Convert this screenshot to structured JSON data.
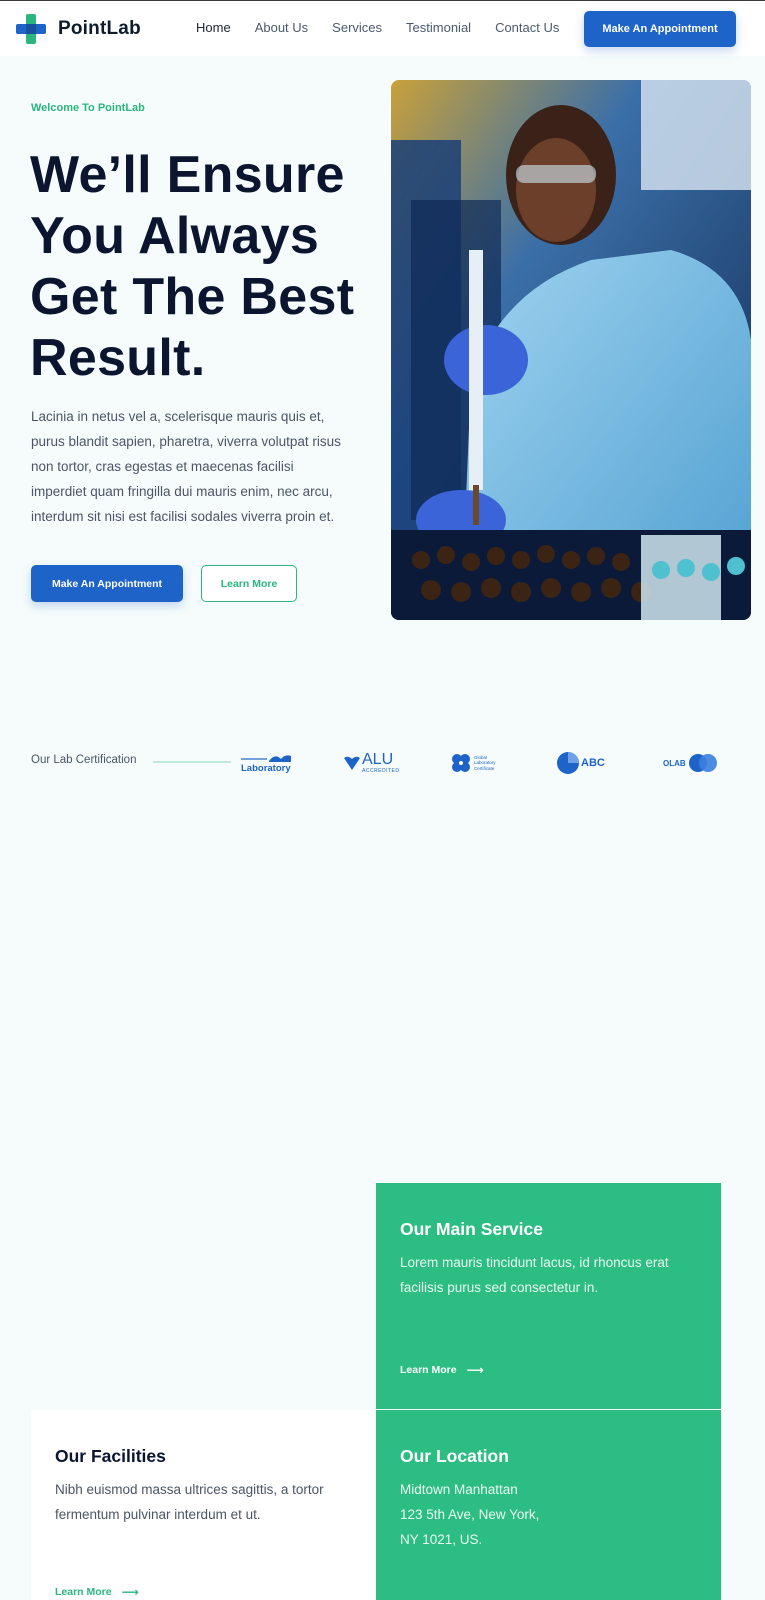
{
  "header": {
    "brand": "PointLab",
    "nav": [
      "Home",
      "About Us",
      "Services",
      "Testimonial",
      "Contact Us"
    ],
    "cta": "Make An Appointment"
  },
  "hero": {
    "eyebrow": "Welcome To PointLab",
    "title": "We’ll Ensure You Always Get The Best Result.",
    "description": "Lacinia in netus vel a, scelerisque mauris quis et, purus blandit sapien, pharetra, viverra volutpat risus non tortor, cras egestas et maecenas facilisi imperdiet quam fringilla dui mauris enim, nec arcu, interdum sit nisi est facilisi sodales viverra proin et.",
    "primary_button": "Make An Appointment",
    "secondary_button": "Learn More"
  },
  "certifications": {
    "label": "Our Lab Certification",
    "logos": {
      "laboratory": "Laboratory",
      "alu": "ALU",
      "alu_sub": "ACCREDITED",
      "global": "Global Laboratory Certificate",
      "abc": "ABC",
      "olab": "OLAB"
    }
  },
  "cards": {
    "service": {
      "title": "Our Main Service",
      "text": "Lorem mauris tincidunt lacus, id rhoncus erat facilisis purus sed consectetur in.",
      "link": "Learn More"
    },
    "facilities": {
      "title": "Our Facilities",
      "text": "Nibh euismod massa ultrices sagittis, a tortor fermentum pulvinar interdum et ut.",
      "link": "Learn More"
    },
    "location": {
      "title": "Our Location",
      "line1": "Midtown Manhattan",
      "line2": "123 5th Ave, New York,",
      "line3": "NY 1021, US."
    }
  },
  "colors": {
    "primary_blue": "#1e63c8",
    "accent_green": "#2cbd82",
    "dark_text": "#0b1530",
    "page_bg": "#f6fcfb"
  }
}
